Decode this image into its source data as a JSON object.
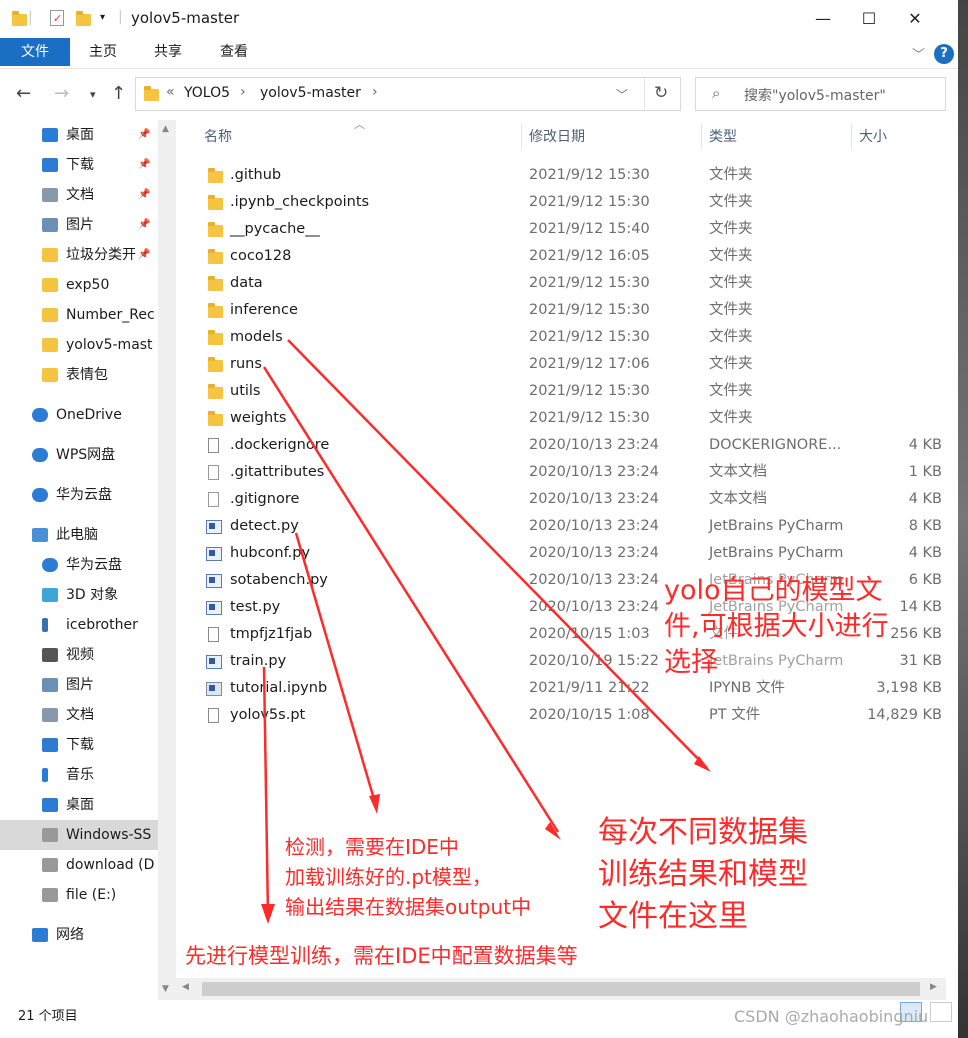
{
  "window": {
    "title": "yolov5-master",
    "controls": [
      "—",
      "☐",
      "✕"
    ]
  },
  "ribbon": {
    "tabs": [
      "文件",
      "主页",
      "共享",
      "查看"
    ]
  },
  "address": {
    "prefix": "«",
    "crumbs": [
      "YOLO5",
      "yolov5-master"
    ]
  },
  "search": {
    "placeholder": "搜索\"yolov5-master\""
  },
  "sidebar": {
    "items": [
      {
        "label": "桌面",
        "icon": "desktop-icon",
        "pinned": true
      },
      {
        "label": "下载",
        "icon": "download-icon",
        "pinned": true
      },
      {
        "label": "文档",
        "icon": "document-icon",
        "pinned": true
      },
      {
        "label": "图片",
        "icon": "picture-icon",
        "pinned": true
      },
      {
        "label": "垃圾分类开",
        "icon": "folder-icon",
        "pinned": true
      },
      {
        "label": "exp50",
        "icon": "folder-icon"
      },
      {
        "label": "Number_Rec",
        "icon": "folder-icon"
      },
      {
        "label": "yolov5-mast",
        "icon": "folder-icon"
      },
      {
        "label": "表情包",
        "icon": "folder-icon"
      },
      {
        "label": "OneDrive",
        "icon": "cloud-icon"
      },
      {
        "label": "WPS网盘",
        "icon": "cloud-icon"
      },
      {
        "label": "华为云盘",
        "icon": "cloud-icon"
      },
      {
        "label": "此电脑",
        "icon": "computer-icon"
      },
      {
        "label": "华为云盘",
        "icon": "cloud-icon"
      },
      {
        "label": "3D 对象",
        "icon": "cube-icon"
      },
      {
        "label": "icebrother",
        "icon": "user-icon"
      },
      {
        "label": "视频",
        "icon": "video-icon"
      },
      {
        "label": "图片",
        "icon": "picture-icon"
      },
      {
        "label": "文档",
        "icon": "document-icon"
      },
      {
        "label": "下载",
        "icon": "download-icon"
      },
      {
        "label": "音乐",
        "icon": "music-icon"
      },
      {
        "label": "桌面",
        "icon": "desktop-icon"
      },
      {
        "label": "Windows-SS",
        "icon": "drive-icon",
        "selected": true
      },
      {
        "label": "download (D",
        "icon": "drive-icon"
      },
      {
        "label": "file (E:)",
        "icon": "drive-icon"
      },
      {
        "label": "网络",
        "icon": "network-icon"
      }
    ]
  },
  "columns": {
    "name": "名称",
    "date": "修改日期",
    "type": "类型",
    "size": "大小"
  },
  "files": [
    {
      "name": ".github",
      "date": "2021/9/12 15:30",
      "type": "文件夹",
      "size": "",
      "kind": "folder"
    },
    {
      "name": ".ipynb_checkpoints",
      "date": "2021/9/12 15:30",
      "type": "文件夹",
      "size": "",
      "kind": "folder"
    },
    {
      "name": "__pycache__",
      "date": "2021/9/12 15:40",
      "type": "文件夹",
      "size": "",
      "kind": "folder"
    },
    {
      "name": "coco128",
      "date": "2021/9/12 16:05",
      "type": "文件夹",
      "size": "",
      "kind": "folder"
    },
    {
      "name": "data",
      "date": "2021/9/12 15:30",
      "type": "文件夹",
      "size": "",
      "kind": "folder"
    },
    {
      "name": "inference",
      "date": "2021/9/12 15:30",
      "type": "文件夹",
      "size": "",
      "kind": "folder"
    },
    {
      "name": "models",
      "date": "2021/9/12 15:30",
      "type": "文件夹",
      "size": "",
      "kind": "folder"
    },
    {
      "name": "runs",
      "date": "2021/9/12 17:06",
      "type": "文件夹",
      "size": "",
      "kind": "folder"
    },
    {
      "name": "utils",
      "date": "2021/9/12 15:30",
      "type": "文件夹",
      "size": "",
      "kind": "folder"
    },
    {
      "name": "weights",
      "date": "2021/9/12 15:30",
      "type": "文件夹",
      "size": "",
      "kind": "folder"
    },
    {
      "name": ".dockerignore",
      "date": "2020/10/13 23:24",
      "type": "DOCKERIGNORE...",
      "size": "4 KB",
      "kind": "file"
    },
    {
      "name": ".gitattributes",
      "date": "2020/10/13 23:24",
      "type": "文本文档",
      "size": "1 KB",
      "kind": "text"
    },
    {
      "name": ".gitignore",
      "date": "2020/10/13 23:24",
      "type": "文本文档",
      "size": "4 KB",
      "kind": "text"
    },
    {
      "name": "detect.py",
      "date": "2020/10/13 23:24",
      "type": "JetBrains PyCharm",
      "size": "8 KB",
      "kind": "py"
    },
    {
      "name": "hubconf.py",
      "date": "2020/10/13 23:24",
      "type": "JetBrains PyCharm",
      "size": "4 KB",
      "kind": "py"
    },
    {
      "name": "sotabench.py",
      "date": "2020/10/13 23:24",
      "type": "JetBrains PyCharm",
      "size": "6 KB",
      "kind": "py"
    },
    {
      "name": "test.py",
      "date": "2020/10/13 23:24",
      "type": "JetBrains PyCharm",
      "size": "14 KB",
      "kind": "py"
    },
    {
      "name": "tmpfjz1fjab",
      "date": "2020/10/15 1:03",
      "type": "文件",
      "size": "256 KB",
      "kind": "file"
    },
    {
      "name": "train.py",
      "date": "2020/10/19 15:22",
      "type": "JetBrains PyCharm",
      "size": "31 KB",
      "kind": "py"
    },
    {
      "name": "tutorial.ipynb",
      "date": "2021/9/11 21:22",
      "type": "IPYNB 文件",
      "size": "3,198 KB",
      "kind": "ipynb"
    },
    {
      "name": "yolov5s.pt",
      "date": "2020/10/15 1:08",
      "type": "PT 文件",
      "size": "14,829 KB",
      "kind": "file"
    }
  ],
  "status": {
    "count": "21 个项目"
  },
  "annotations": {
    "models_note": [
      "yolo自己的模型文",
      "件,可根据大小进行",
      "选择"
    ],
    "runs_note": [
      "每次不同数据集",
      "训练结果和模型",
      "文件在这里"
    ],
    "detect_note": [
      "检测，需要在IDE中",
      "加载训练好的.pt模型，",
      "输出结果在数据集output中"
    ],
    "train_note": "先进行模型训练，需在IDE中配置数据集等"
  },
  "watermark": "CSDN @zhaohaobingniu",
  "colors": {
    "accent": "#1a6fc4",
    "annotation": "#ff2a2a",
    "folder": "#f5c542"
  }
}
